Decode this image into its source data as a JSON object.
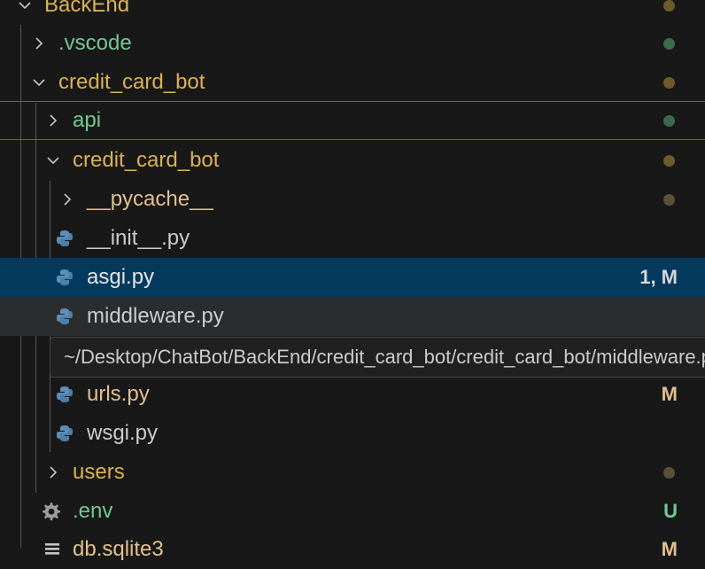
{
  "explorer": {
    "rows": [
      {
        "label": "BackEnd",
        "color": "#D9B253",
        "status": "dot-yellow",
        "badge": ""
      },
      {
        "label": ".vscode",
        "color": "#73C991",
        "status": "dot-green",
        "badge": ""
      },
      {
        "label": "credit_card_bot",
        "color": "#D9B253",
        "status": "dot-yellow",
        "badge": ""
      },
      {
        "label": "api",
        "color": "#73C991",
        "status": "dot-green",
        "badge": ""
      },
      {
        "label": "credit_card_bot",
        "color": "#D9B253",
        "status": "dot-yellow",
        "badge": ""
      },
      {
        "label": "__pycache__",
        "color": "#E2C08D",
        "status": "dot-grey",
        "badge": ""
      },
      {
        "label": "__init__.py",
        "color": "#CCCCCC",
        "status": "",
        "badge": ""
      },
      {
        "label": "asgi.py",
        "color": "#E2C08D",
        "status": "",
        "badge": "1, M"
      },
      {
        "label": "middleware.py",
        "color": "#CCCCCC",
        "status": "",
        "badge": ""
      },
      {
        "label": "urls.py",
        "color": "#E2C08D",
        "status": "",
        "badge": "M"
      },
      {
        "label": "wsgi.py",
        "color": "#CCCCCC",
        "status": "",
        "badge": ""
      },
      {
        "label": "users",
        "color": "#D9B253",
        "status": "dot-grey",
        "badge": ""
      },
      {
        "label": ".env",
        "color": "#73C991",
        "status": "",
        "badge": "U"
      },
      {
        "label": "db.sqlite3",
        "color": "#E2C08D",
        "status": "",
        "badge": "M"
      }
    ]
  },
  "tooltip": {
    "path": "~/Desktop/ChatBot/BackEnd/credit_card_bot/credit_card_bot/middleware.py"
  },
  "icons": {
    "folder_closed": "chevron-right-icon",
    "folder_open": "chevron-down-icon",
    "python_file": "python-icon",
    "env_file": "gear-icon",
    "database_file": "database-icon"
  },
  "colors": {
    "selection": "#04395E",
    "focus_outline": "#2F6FBA",
    "modified": "#E2C08D",
    "untracked": "#73C991",
    "folder_modified": "#D9B253"
  }
}
